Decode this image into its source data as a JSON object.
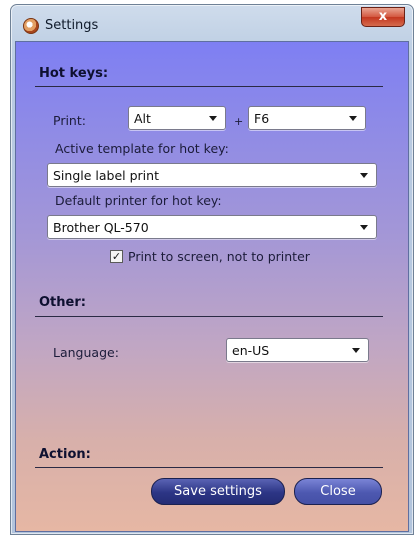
{
  "window": {
    "title": "Settings",
    "close_label": "x"
  },
  "hotkeys": {
    "section_title": "Hot keys:",
    "print_label": "Print:",
    "modifier_value": "Alt",
    "plus": "+",
    "key_value": "F6",
    "template_label": "Active template for hot key:",
    "template_value": "Single label print",
    "printer_label": "Default printer for hot key:",
    "printer_value": "Brother QL-570",
    "screen_checkbox_label": "Print to screen, not to printer",
    "screen_checkbox_checked": true
  },
  "other": {
    "section_title": "Other:",
    "language_label": "Language:",
    "language_value": "en-US"
  },
  "action": {
    "section_title": "Action:",
    "save_label": "Save settings",
    "close_label": "Close"
  }
}
